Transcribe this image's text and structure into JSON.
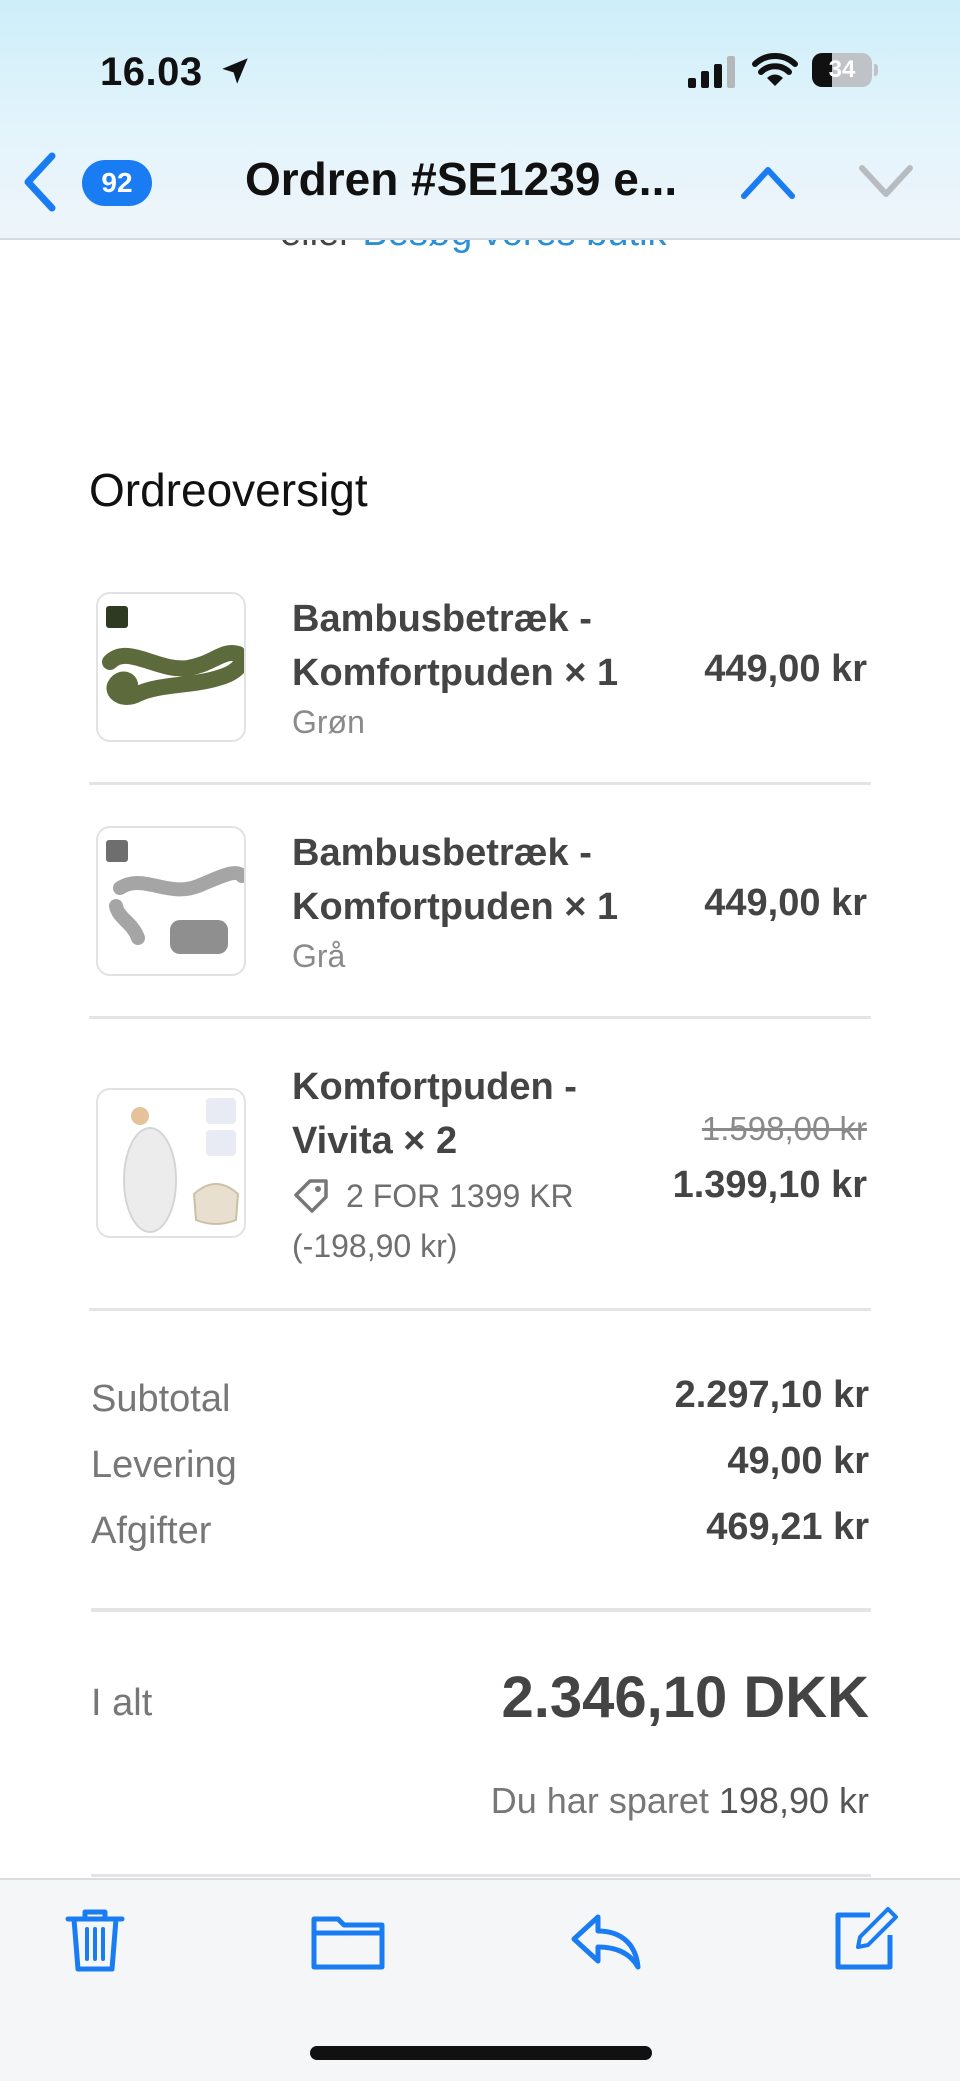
{
  "status_bar": {
    "time": "16.03",
    "battery": "34",
    "battery_level": 0.34
  },
  "nav": {
    "unread_count": "92",
    "title": "Ordren #SE1239 e..."
  },
  "cropped_text": {
    "prefix": "eller",
    "link": "Besøg vores butik"
  },
  "section_title": "Ordreoversigt",
  "items": [
    {
      "name": "Bambusbetræk - Komfortpuden × 1",
      "variant": "Grøn",
      "price": "449,00 kr",
      "color": "#5d6a3c"
    },
    {
      "name": "Bambusbetræk - Komfortpuden × 1",
      "variant": "Grå",
      "price": "449,00 kr",
      "color": "#9a9a9a"
    },
    {
      "name": "Komfortpuden - Vivita × 2",
      "discount_code": "2 FOR 1399 KR",
      "discount_amount": "(-198,90 kr)",
      "old_price": "1.598,00 kr",
      "price": "1.399,10 kr",
      "color": "#f3f3f3"
    }
  ],
  "summary": [
    {
      "label": "Subtotal",
      "value": "2.297,10 kr"
    },
    {
      "label": "Levering",
      "value": "49,00 kr"
    },
    {
      "label": "Afgifter",
      "value": "469,21 kr"
    }
  ],
  "total": {
    "label": "I alt",
    "value": "2.346,10 DKK"
  },
  "saved": {
    "text": "Du har sparet",
    "amount": "198,90 kr"
  },
  "colors": {
    "accent": "#1a7cf2",
    "link": "#2a8fd6"
  },
  "toolbar": {
    "icons": [
      "trash-icon",
      "folder-icon",
      "reply-icon",
      "compose-icon"
    ]
  }
}
